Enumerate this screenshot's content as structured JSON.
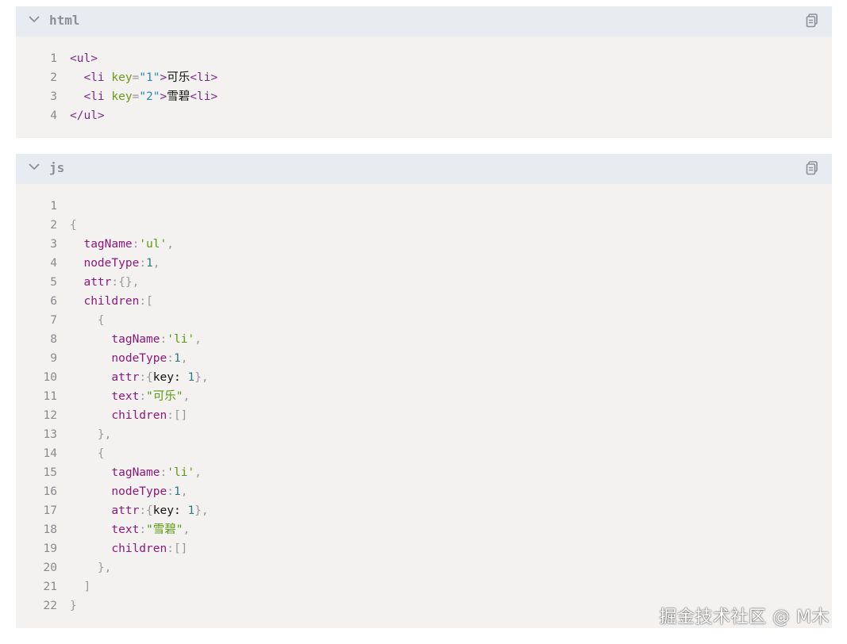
{
  "blocks": [
    {
      "lang": "html",
      "lines": [
        {
          "n": "1",
          "tokens": [
            {
              "t": "<ul>",
              "c": "t-tag"
            }
          ]
        },
        {
          "n": "2",
          "tokens": [
            {
              "t": "  <li ",
              "c": "t-tag"
            },
            {
              "t": "key",
              "c": "t-attr"
            },
            {
              "t": "=",
              "c": "t-punc"
            },
            {
              "t": "\"1\"",
              "c": "t-str"
            },
            {
              "t": ">",
              "c": "t-tag"
            },
            {
              "t": "可乐",
              "c": "t-text"
            },
            {
              "t": "<li>",
              "c": "t-tag"
            }
          ]
        },
        {
          "n": "3",
          "tokens": [
            {
              "t": "  <li ",
              "c": "t-tag"
            },
            {
              "t": "key",
              "c": "t-attr"
            },
            {
              "t": "=",
              "c": "t-punc"
            },
            {
              "t": "\"2\"",
              "c": "t-str"
            },
            {
              "t": ">",
              "c": "t-tag"
            },
            {
              "t": "雪碧",
              "c": "t-text"
            },
            {
              "t": "<li>",
              "c": "t-tag"
            }
          ]
        },
        {
          "n": "4",
          "tokens": [
            {
              "t": "</ul>",
              "c": "t-tag"
            }
          ]
        }
      ]
    },
    {
      "lang": "js",
      "lines": [
        {
          "n": "1",
          "tokens": []
        },
        {
          "n": "2",
          "tokens": [
            {
              "t": "{",
              "c": "t-punc"
            }
          ]
        },
        {
          "n": "3",
          "tokens": [
            {
              "t": "  tagName",
              "c": "t-key"
            },
            {
              "t": ":",
              "c": "t-punc"
            },
            {
              "t": "'ul'",
              "c": "t-sq"
            },
            {
              "t": ",",
              "c": "t-punc"
            }
          ]
        },
        {
          "n": "4",
          "tokens": [
            {
              "t": "  nodeType",
              "c": "t-key"
            },
            {
              "t": ":",
              "c": "t-punc"
            },
            {
              "t": "1",
              "c": "t-num"
            },
            {
              "t": ",",
              "c": "t-punc"
            }
          ]
        },
        {
          "n": "5",
          "tokens": [
            {
              "t": "  attr",
              "c": "t-key"
            },
            {
              "t": ":{},",
              "c": "t-punc"
            }
          ]
        },
        {
          "n": "6",
          "tokens": [
            {
              "t": "  children",
              "c": "t-key"
            },
            {
              "t": ":[",
              "c": "t-punc"
            }
          ]
        },
        {
          "n": "7",
          "tokens": [
            {
              "t": "    {",
              "c": "t-punc"
            }
          ]
        },
        {
          "n": "8",
          "tokens": [
            {
              "t": "      tagName",
              "c": "t-key"
            },
            {
              "t": ":",
              "c": "t-punc"
            },
            {
              "t": "'li'",
              "c": "t-sq"
            },
            {
              "t": ",",
              "c": "t-punc"
            }
          ]
        },
        {
          "n": "9",
          "tokens": [
            {
              "t": "      nodeType",
              "c": "t-key"
            },
            {
              "t": ":",
              "c": "t-punc"
            },
            {
              "t": "1",
              "c": "t-num"
            },
            {
              "t": ",",
              "c": "t-punc"
            }
          ]
        },
        {
          "n": "10",
          "tokens": [
            {
              "t": "      attr",
              "c": "t-key"
            },
            {
              "t": ":{",
              "c": "t-punc"
            },
            {
              "t": "key: ",
              "c": "t-plain"
            },
            {
              "t": "1",
              "c": "t-num"
            },
            {
              "t": "},",
              "c": "t-punc"
            }
          ]
        },
        {
          "n": "11",
          "tokens": [
            {
              "t": "      text",
              "c": "t-key"
            },
            {
              "t": ":",
              "c": "t-punc"
            },
            {
              "t": "\"可乐\"",
              "c": "t-cn"
            },
            {
              "t": ",",
              "c": "t-punc"
            }
          ]
        },
        {
          "n": "12",
          "tokens": [
            {
              "t": "      children",
              "c": "t-key"
            },
            {
              "t": ":[]",
              "c": "t-punc"
            }
          ]
        },
        {
          "n": "13",
          "tokens": [
            {
              "t": "    },",
              "c": "t-punc"
            }
          ]
        },
        {
          "n": "14",
          "tokens": [
            {
              "t": "    {",
              "c": "t-punc"
            }
          ]
        },
        {
          "n": "15",
          "tokens": [
            {
              "t": "      tagName",
              "c": "t-key"
            },
            {
              "t": ":",
              "c": "t-punc"
            },
            {
              "t": "'li'",
              "c": "t-sq"
            },
            {
              "t": ",",
              "c": "t-punc"
            }
          ]
        },
        {
          "n": "16",
          "tokens": [
            {
              "t": "      nodeType",
              "c": "t-key"
            },
            {
              "t": ":",
              "c": "t-punc"
            },
            {
              "t": "1",
              "c": "t-num"
            },
            {
              "t": ",",
              "c": "t-punc"
            }
          ]
        },
        {
          "n": "17",
          "tokens": [
            {
              "t": "      attr",
              "c": "t-key"
            },
            {
              "t": ":{",
              "c": "t-punc"
            },
            {
              "t": "key: ",
              "c": "t-plain"
            },
            {
              "t": "1",
              "c": "t-num"
            },
            {
              "t": "},",
              "c": "t-punc"
            }
          ]
        },
        {
          "n": "18",
          "tokens": [
            {
              "t": "      text",
              "c": "t-key"
            },
            {
              "t": ":",
              "c": "t-punc"
            },
            {
              "t": "\"雪碧\"",
              "c": "t-cn"
            },
            {
              "t": ",",
              "c": "t-punc"
            }
          ]
        },
        {
          "n": "19",
          "tokens": [
            {
              "t": "      children",
              "c": "t-key"
            },
            {
              "t": ":[]",
              "c": "t-punc"
            }
          ]
        },
        {
          "n": "20",
          "tokens": [
            {
              "t": "    },",
              "c": "t-punc"
            }
          ]
        },
        {
          "n": "21",
          "tokens": [
            {
              "t": "  ]",
              "c": "t-punc"
            }
          ]
        },
        {
          "n": "22",
          "tokens": [
            {
              "t": "}",
              "c": "t-punc"
            }
          ]
        }
      ]
    }
  ],
  "icons": {
    "collapse": "chevron-down-icon",
    "copy": "copy-icon"
  },
  "watermark": "掘金技术社区 @ M木",
  "colors": {
    "header_bg": "#e8ebf0",
    "code_bg": "#f4f2f0"
  }
}
